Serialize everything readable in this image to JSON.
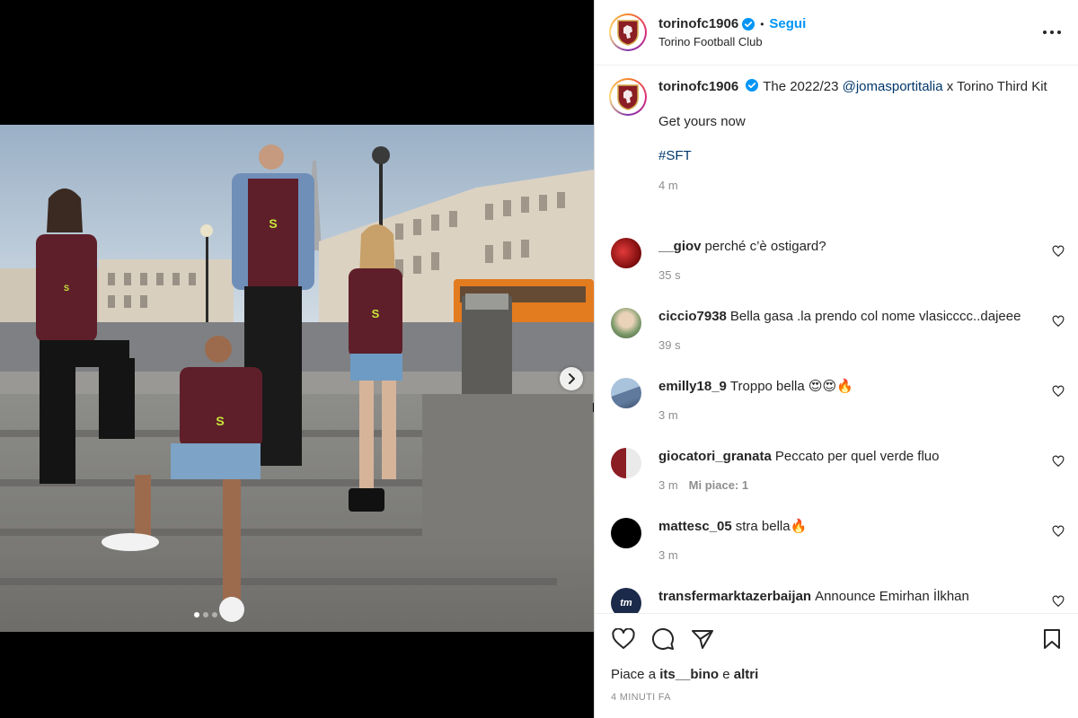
{
  "header": {
    "username": "torinofc1906",
    "separator": "•",
    "follow_label": "Segui",
    "subtitle": "Torino Football Club",
    "more_icon": "more-horizontal-icon",
    "avatar_logo_text": "Torino"
  },
  "caption": {
    "username": "torinofc1906",
    "text_prefix": "The 2022/23 ",
    "mention": "@jomasportitalia",
    "text_suffix": " x Torino Third Kit",
    "line2": "Get yours now",
    "hashtag": "#SFT",
    "time": "4 m"
  },
  "comments": [
    {
      "username": "__giov",
      "text": "perché c’è ostigard?",
      "time": "35 s",
      "likes": ""
    },
    {
      "username": "ciccio7938",
      "text": "Bella gasa .la prendo col nome vlasicccc..dajeee",
      "time": "39 s",
      "likes": ""
    },
    {
      "username": "emilly18_9",
      "text": "Troppo bella 😍😍🔥",
      "time": "3 m",
      "likes": ""
    },
    {
      "username": "giocatori_granata",
      "text": "Peccato per quel verde fluo",
      "time": "3 m",
      "likes": "Mi piace: 1"
    },
    {
      "username": "mattesc_05",
      "text": "stra bella🔥",
      "time": "3 m",
      "likes": ""
    },
    {
      "username": "transfermarktazerbaijan",
      "text": "Announce Emirhan İlkhan",
      "time": "",
      "likes": "",
      "avatar_text": "tm"
    }
  ],
  "actions": {
    "icons": [
      "heart-icon",
      "comment-icon",
      "share-icon",
      "bookmark-icon"
    ],
    "likes_prefix": "Piace a ",
    "likes_user": "its__bino",
    "likes_middle": " e ",
    "likes_others": "altri",
    "timestamp": "4 MINUTI FA"
  },
  "media": {
    "carousel_dots": 3,
    "active_dot": 0,
    "next_icon": "chevron-right-icon",
    "shirt_sponsor": "SUZUKI"
  },
  "colors": {
    "accent": "#0095f6",
    "link": "#00376b",
    "muted": "#8e8e8e",
    "verified": "#0095f6",
    "granata": "#5e1f2a",
    "fluo": "#c8e639"
  }
}
